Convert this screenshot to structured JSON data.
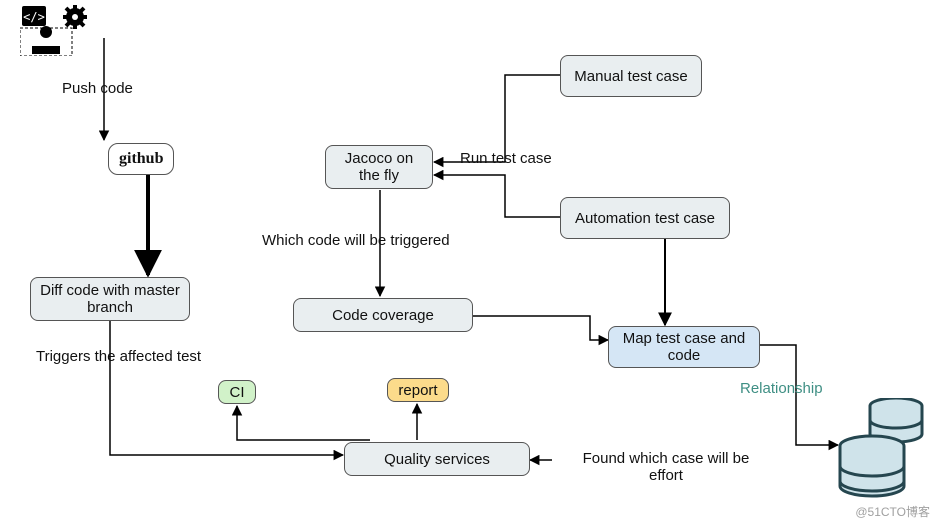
{
  "diagram": {
    "icons": {
      "dev": "developer-icon",
      "gear": "gear-icon",
      "db": "database-icon"
    },
    "nodes": {
      "github": "github",
      "diff": "Diff code with master branch",
      "jacoco": "Jacoco on the fly",
      "manual": "Manual test case",
      "automation": "Automation test case",
      "coverage": "Code coverage",
      "map": "Map test case and code",
      "ci": "CI",
      "report": "report",
      "quality": "Quality services"
    },
    "edgeLabels": {
      "push": "Push code",
      "runTest": "Run test case",
      "whichCode": "Which code will be triggered",
      "triggersAffected": "Triggers the affected test",
      "relationship": "Relationship",
      "foundCase": "Found which case will be effort"
    },
    "watermark": "@51CTO博客"
  }
}
